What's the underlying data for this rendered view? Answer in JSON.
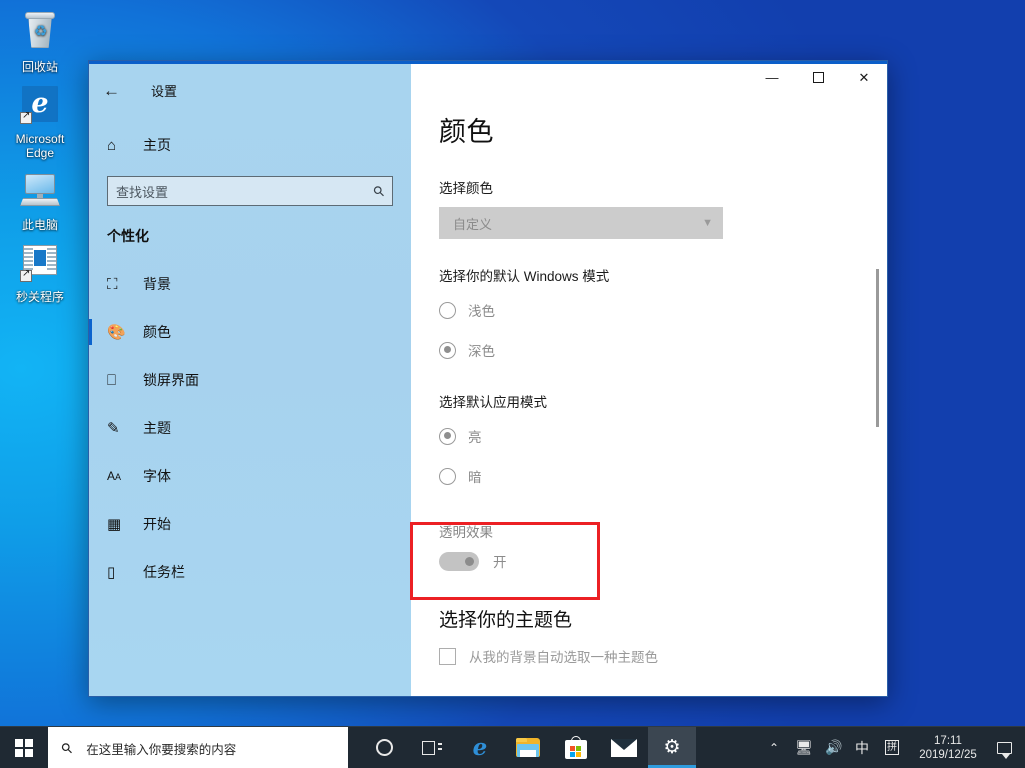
{
  "desktop": {
    "icons": [
      {
        "label": "回收站",
        "icon": "recycle-bin-icon"
      },
      {
        "label": "Microsoft Edge",
        "icon": "edge-icon"
      },
      {
        "label": "此电脑",
        "icon": "this-pc-icon"
      },
      {
        "label": "秒关程序",
        "icon": "app-shortcut-icon"
      }
    ]
  },
  "window": {
    "title": "设置",
    "back_icon": "back-arrow-icon",
    "controls": {
      "minimize": "—",
      "maximize": "maximize-icon",
      "close": "✕"
    }
  },
  "sidebar": {
    "home_label": "主页",
    "home_icon": "home-icon",
    "search": {
      "placeholder": "查找设置",
      "icon": "search-icon"
    },
    "category": "个性化",
    "items": [
      {
        "label": "背景",
        "icon": "picture-icon",
        "selected": false
      },
      {
        "label": "颜色",
        "icon": "palette-icon",
        "selected": true
      },
      {
        "label": "锁屏界面",
        "icon": "lock-screen-icon",
        "selected": false
      },
      {
        "label": "主题",
        "icon": "brush-icon",
        "selected": false
      },
      {
        "label": "字体",
        "icon": "font-icon",
        "selected": false
      },
      {
        "label": "开始",
        "icon": "start-menu-icon",
        "selected": false
      },
      {
        "label": "任务栏",
        "icon": "taskbar-icon",
        "selected": false
      }
    ]
  },
  "main": {
    "page_title": "颜色",
    "choose_color": {
      "label": "选择颜色",
      "value": "自定义",
      "chevron": "chevron-down-icon"
    },
    "windows_mode": {
      "label": "选择你的默认 Windows 模式",
      "options": [
        {
          "label": "浅色",
          "checked": false
        },
        {
          "label": "深色",
          "checked": true
        }
      ]
    },
    "app_mode": {
      "label": "选择默认应用模式",
      "options": [
        {
          "label": "亮",
          "checked": true
        },
        {
          "label": "暗",
          "checked": false
        }
      ]
    },
    "transparency": {
      "label": "透明效果",
      "state_label": "开",
      "on": true
    },
    "accent": {
      "heading": "选择你的主题色",
      "checkbox_label": "从我的背景自动选取一种主题色",
      "checked": false
    }
  },
  "taskbar": {
    "start_icon": "windows-start-icon",
    "search": {
      "placeholder": "在这里输入你要搜索的内容",
      "icon": "search-icon"
    },
    "apps": [
      {
        "name": "cortana-icon",
        "active": false
      },
      {
        "name": "task-view-icon",
        "active": false
      },
      {
        "name": "edge-icon",
        "active": false
      },
      {
        "name": "file-explorer-icon",
        "active": false
      },
      {
        "name": "microsoft-store-icon",
        "active": false
      },
      {
        "name": "mail-icon",
        "active": false
      },
      {
        "name": "settings-gear-icon",
        "active": true
      }
    ],
    "tray": {
      "chevron": "⌃",
      "network_icon": "network-icon",
      "volume_icon": "volume-icon",
      "ime_label": "中",
      "pinyin_label": "拼",
      "time": "17:11",
      "date": "2019/12/25",
      "notification_icon": "notification-icon"
    }
  },
  "highlight": {
    "color": "#ec2024",
    "target": "transparency-toggle"
  }
}
